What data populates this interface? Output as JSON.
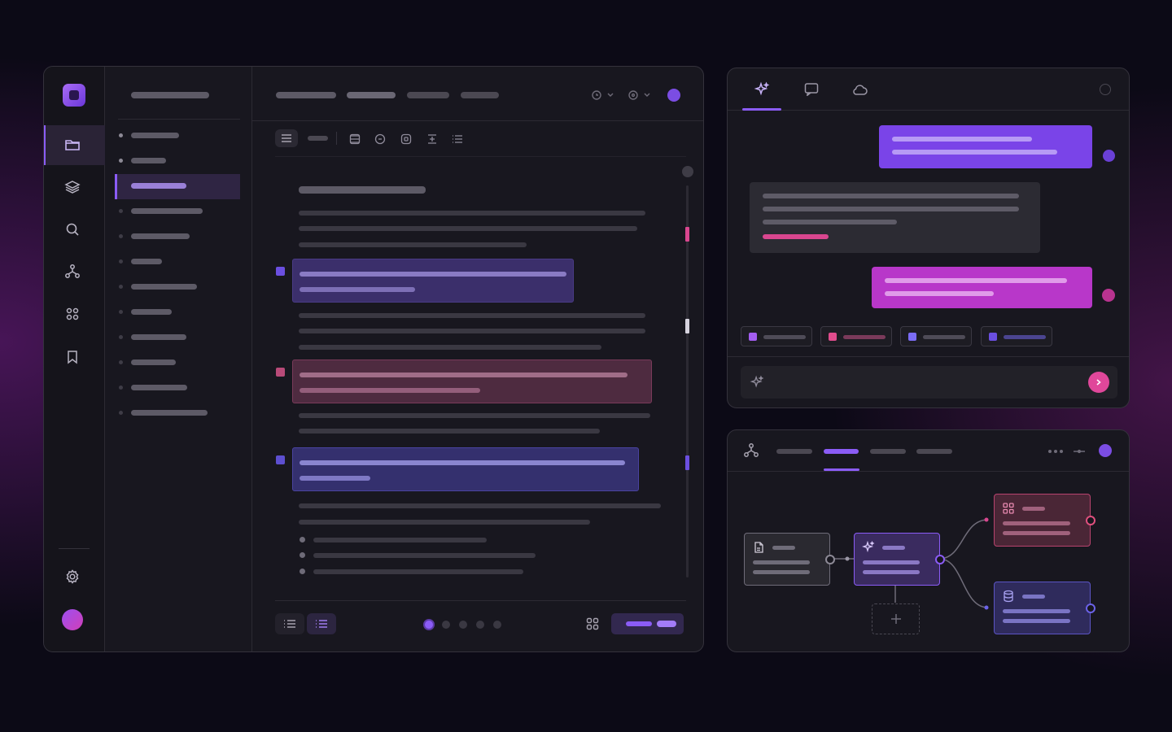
{
  "app": {
    "icons": {
      "logo": "app-logo-icon",
      "rail": [
        "folder-icon",
        "layers-icon",
        "search-icon",
        "network-icon",
        "grid-icon",
        "bookmark-icon"
      ],
      "settings": "gear-icon",
      "toolbar": [
        "align-left-icon",
        "dash-icon",
        "list-filter-icon",
        "badge-icon",
        "square-dot-icon",
        "split-icon",
        "list-icon"
      ],
      "footer": [
        "list-icon",
        "list-icon",
        "grid-icon"
      ]
    },
    "accent": "#8b5cf6",
    "pagination": {
      "pages": 5,
      "active": 1
    },
    "selected_tree_item": 3
  },
  "chat": {
    "tabs": [
      "sparkles-icon",
      "chat-icon",
      "cloud-icon"
    ],
    "active_tab": 1,
    "user_bubble_color": "#7a44e8",
    "alt_bubble_color": "#b837c9",
    "highlight_color": "#d9468f",
    "chip_colors": [
      "#a35df0",
      "#e04c8c",
      "#7b6cf5",
      "#6b4fe0"
    ],
    "input_icon": "sparkles-icon",
    "send_icon": "send-arrow-icon"
  },
  "workflow": {
    "header_icon": "network-icon",
    "active_tab": 2,
    "nodes": [
      {
        "icon": "document-icon",
        "color": "#8d8a96"
      },
      {
        "icon": "sparkles-icon",
        "color": "#8b5cf6"
      },
      {
        "icon": "grid-icon",
        "color": "#e0507e"
      },
      {
        "icon": "database-icon",
        "color": "#6b62e8"
      }
    ],
    "add_node_icon": "plus-icon"
  }
}
